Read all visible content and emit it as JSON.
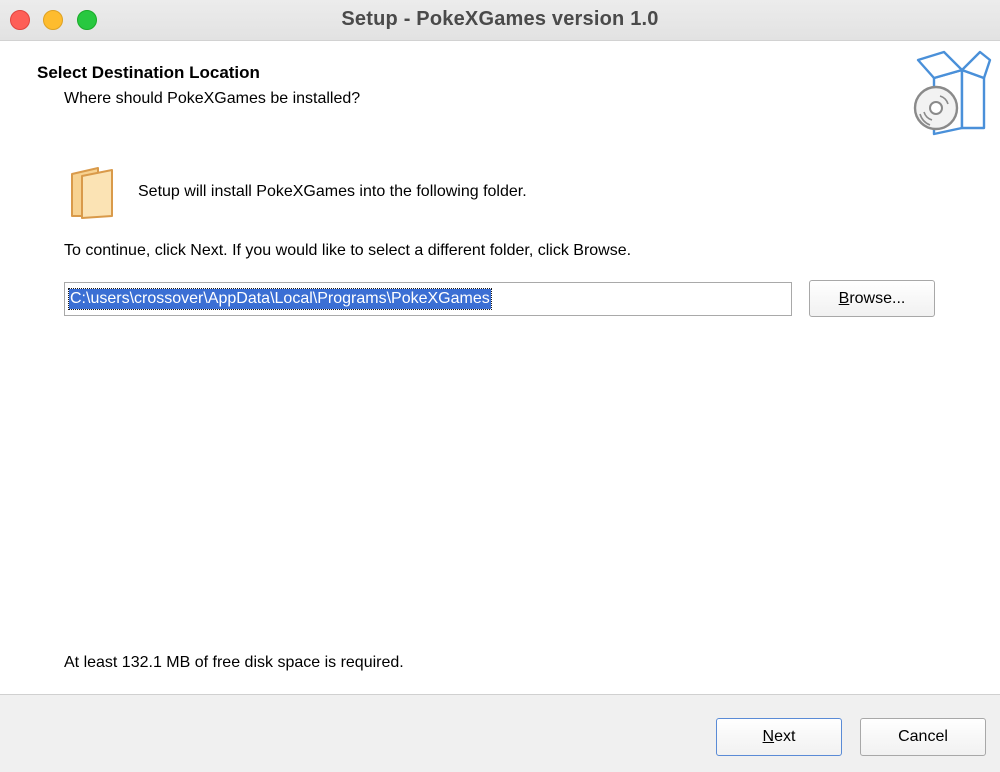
{
  "window": {
    "title": "Setup - PokeXGames version 1.0"
  },
  "header": {
    "title": "Select Destination Location",
    "subtitle": "Where should PokeXGames be installed?",
    "icon": "software-box-icon"
  },
  "main": {
    "folder_icon": "folder-icon",
    "install_text": "Setup will install PokeXGames into the following folder.",
    "continue_text": "To continue, click Next. If you would like to select a different folder, click Browse.",
    "path_value": "C:\\users\\crossover\\AppData\\Local\\Programs\\PokeXGames",
    "browse": {
      "mnemonic": "B",
      "rest": "rowse..."
    },
    "disk_space_text": "At least 132.1 MB of free disk space is required."
  },
  "footer": {
    "next": {
      "mnemonic": "N",
      "rest": "ext"
    },
    "cancel_label": "Cancel"
  },
  "colors": {
    "selection": "#3b6fd4",
    "close": "#fe5f57",
    "minimize": "#febc2e",
    "maximize": "#28c840"
  }
}
